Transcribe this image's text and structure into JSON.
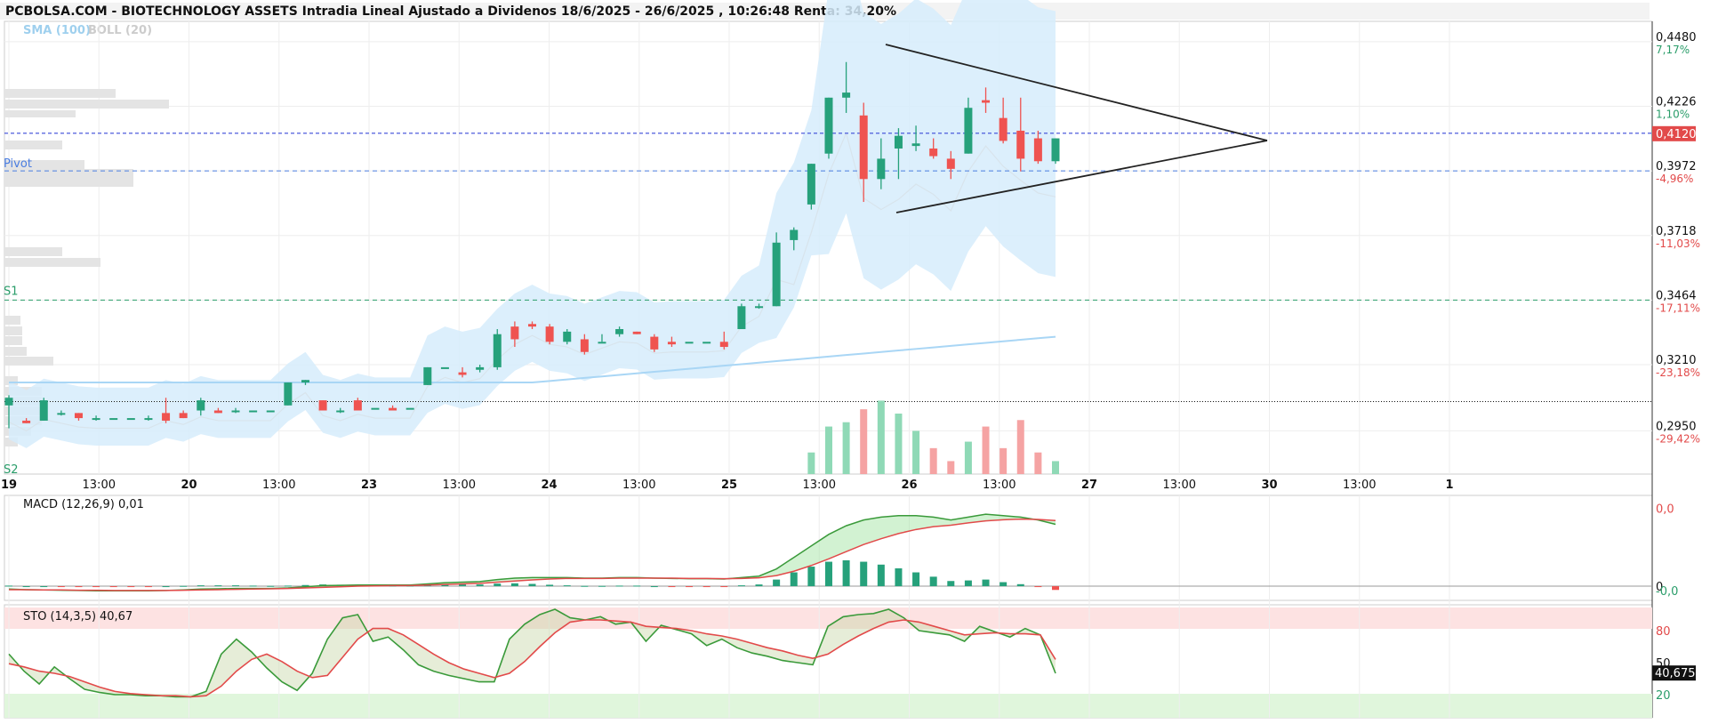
{
  "header": {
    "title": "PCBOLSA.COM - BIOTECHNOLOGY ASSETS Intradia Lineal Ajustado a Dividenos 18/6/2025 - 26/6/2025 , 10:26:48 Renta: 34,20%",
    "sma_label": "SMA (100)",
    "boll_label": "BOLL (20)"
  },
  "colors": {
    "up": "#26a17b",
    "down": "#ef5350",
    "band": "#d6ecfb",
    "sma": "#a9d6f5",
    "pivot": "#4a7de0",
    "s1": "#2a9d6a",
    "last": "#e24a4a"
  },
  "levels": {
    "pivot_label": "Pivot",
    "s1_label": "S1",
    "s2_label": "S2",
    "last_price_label": "0,4120",
    "pivot": 0.3972,
    "s1": 0.3464,
    "last": 0.412,
    "dotted": 0.3065
  },
  "chart_data": [
    {
      "type": "candlestick",
      "ylim": [
        0.278,
        0.456
      ],
      "y_ticks": [
        {
          "value": 0.448,
          "label": "0,4480",
          "pct": "7,17%"
        },
        {
          "value": 0.4226,
          "label": "0,4226",
          "pct": "1,10%"
        },
        {
          "value": 0.3972,
          "label": "0,3972",
          "pct": "-4,96%"
        },
        {
          "value": 0.3718,
          "label": "0,3718",
          "pct": "-11,03%"
        },
        {
          "value": 0.3464,
          "label": "0,3464",
          "pct": "-17,11%"
        },
        {
          "value": 0.321,
          "label": "0,3210",
          "pct": "-23,18%"
        },
        {
          "value": 0.295,
          "label": "0,2950",
          "pct": "-29,42%"
        }
      ],
      "x_ticks": [
        {
          "slot": 0,
          "label": "19",
          "bold": true
        },
        {
          "slot": 4.5,
          "label": "13:00",
          "bold": false
        },
        {
          "slot": 9,
          "label": "20",
          "bold": true
        },
        {
          "slot": 13.5,
          "label": "13:00",
          "bold": false
        },
        {
          "slot": 18,
          "label": "23",
          "bold": true
        },
        {
          "slot": 22.5,
          "label": "13:00",
          "bold": false
        },
        {
          "slot": 27,
          "label": "24",
          "bold": true
        },
        {
          "slot": 31.5,
          "label": "13:00",
          "bold": false
        },
        {
          "slot": 36,
          "label": "25",
          "bold": true
        },
        {
          "slot": 40.5,
          "label": "13:00",
          "bold": false
        },
        {
          "slot": 45,
          "label": "26",
          "bold": true
        },
        {
          "slot": 49.5,
          "label": "13:00",
          "bold": false
        },
        {
          "slot": 54,
          "label": "27",
          "bold": true
        },
        {
          "slot": 58.5,
          "label": "13:00",
          "bold": false
        },
        {
          "slot": 63,
          "label": "30",
          "bold": true
        },
        {
          "slot": 67.5,
          "label": "13:00",
          "bold": false
        },
        {
          "slot": 72,
          "label": "1",
          "bold": true
        }
      ],
      "candles": [
        {
          "o": 0.305,
          "h": 0.309,
          "l": 0.296,
          "c": 0.308
        },
        {
          "o": 0.299,
          "h": 0.3,
          "l": 0.298,
          "c": 0.298
        },
        {
          "o": 0.299,
          "h": 0.308,
          "l": 0.299,
          "c": 0.307
        },
        {
          "o": 0.302,
          "h": 0.303,
          "l": 0.301,
          "c": 0.302
        },
        {
          "o": 0.302,
          "h": 0.302,
          "l": 0.299,
          "c": 0.3
        },
        {
          "o": 0.3,
          "h": 0.301,
          "l": 0.299,
          "c": 0.3
        },
        {
          "o": 0.3,
          "h": 0.3,
          "l": 0.3,
          "c": 0.3
        },
        {
          "o": 0.3,
          "h": 0.3,
          "l": 0.3,
          "c": 0.3
        },
        {
          "o": 0.3,
          "h": 0.301,
          "l": 0.299,
          "c": 0.3
        },
        {
          "o": 0.302,
          "h": 0.308,
          "l": 0.298,
          "c": 0.299
        },
        {
          "o": 0.302,
          "h": 0.303,
          "l": 0.3,
          "c": 0.3
        },
        {
          "o": 0.303,
          "h": 0.308,
          "l": 0.301,
          "c": 0.307
        },
        {
          "o": 0.303,
          "h": 0.304,
          "l": 0.302,
          "c": 0.302
        },
        {
          "o": 0.303,
          "h": 0.304,
          "l": 0.302,
          "c": 0.303
        },
        {
          "o": 0.303,
          "h": 0.303,
          "l": 0.303,
          "c": 0.303
        },
        {
          "o": 0.303,
          "h": 0.303,
          "l": 0.303,
          "c": 0.303
        },
        {
          "o": 0.305,
          "h": 0.314,
          "l": 0.305,
          "c": 0.314
        },
        {
          "o": 0.314,
          "h": 0.315,
          "l": 0.313,
          "c": 0.315
        },
        {
          "o": 0.307,
          "h": 0.307,
          "l": 0.303,
          "c": 0.303
        },
        {
          "o": 0.303,
          "h": 0.304,
          "l": 0.302,
          "c": 0.303
        },
        {
          "o": 0.307,
          "h": 0.308,
          "l": 0.303,
          "c": 0.303
        },
        {
          "o": 0.304,
          "h": 0.304,
          "l": 0.304,
          "c": 0.304
        },
        {
          "o": 0.304,
          "h": 0.305,
          "l": 0.303,
          "c": 0.303
        },
        {
          "o": 0.304,
          "h": 0.304,
          "l": 0.304,
          "c": 0.304
        },
        {
          "o": 0.313,
          "h": 0.32,
          "l": 0.313,
          "c": 0.32
        },
        {
          "o": 0.32,
          "h": 0.32,
          "l": 0.32,
          "c": 0.32
        },
        {
          "o": 0.318,
          "h": 0.32,
          "l": 0.316,
          "c": 0.317
        },
        {
          "o": 0.319,
          "h": 0.321,
          "l": 0.318,
          "c": 0.32
        },
        {
          "o": 0.32,
          "h": 0.335,
          "l": 0.319,
          "c": 0.333
        },
        {
          "o": 0.336,
          "h": 0.338,
          "l": 0.328,
          "c": 0.331
        },
        {
          "o": 0.337,
          "h": 0.338,
          "l": 0.335,
          "c": 0.336
        },
        {
          "o": 0.336,
          "h": 0.337,
          "l": 0.329,
          "c": 0.33
        },
        {
          "o": 0.33,
          "h": 0.335,
          "l": 0.329,
          "c": 0.334
        },
        {
          "o": 0.331,
          "h": 0.333,
          "l": 0.325,
          "c": 0.326
        },
        {
          "o": 0.33,
          "h": 0.333,
          "l": 0.33,
          "c": 0.33
        },
        {
          "o": 0.333,
          "h": 0.336,
          "l": 0.332,
          "c": 0.335
        },
        {
          "o": 0.334,
          "h": 0.334,
          "l": 0.333,
          "c": 0.333
        },
        {
          "o": 0.332,
          "h": 0.333,
          "l": 0.326,
          "c": 0.327
        },
        {
          "o": 0.33,
          "h": 0.332,
          "l": 0.328,
          "c": 0.329
        },
        {
          "o": 0.33,
          "h": 0.33,
          "l": 0.33,
          "c": 0.33
        },
        {
          "o": 0.33,
          "h": 0.33,
          "l": 0.33,
          "c": 0.33
        },
        {
          "o": 0.33,
          "h": 0.334,
          "l": 0.327,
          "c": 0.328
        },
        {
          "o": 0.335,
          "h": 0.345,
          "l": 0.335,
          "c": 0.344
        },
        {
          "o": 0.344,
          "h": 0.345,
          "l": 0.343,
          "c": 0.344
        },
        {
          "o": 0.344,
          "h": 0.373,
          "l": 0.344,
          "c": 0.369
        },
        {
          "o": 0.37,
          "h": 0.375,
          "l": 0.366,
          "c": 0.374
        },
        {
          "o": 0.384,
          "h": 0.4,
          "l": 0.382,
          "c": 0.4
        },
        {
          "o": 0.404,
          "h": 0.426,
          "l": 0.402,
          "c": 0.426
        },
        {
          "o": 0.426,
          "h": 0.44,
          "l": 0.42,
          "c": 0.428
        },
        {
          "o": 0.419,
          "h": 0.424,
          "l": 0.385,
          "c": 0.394
        },
        {
          "o": 0.394,
          "h": 0.41,
          "l": 0.39,
          "c": 0.402
        },
        {
          "o": 0.406,
          "h": 0.414,
          "l": 0.394,
          "c": 0.411
        },
        {
          "o": 0.407,
          "h": 0.415,
          "l": 0.405,
          "c": 0.408
        },
        {
          "o": 0.406,
          "h": 0.41,
          "l": 0.402,
          "c": 0.403
        },
        {
          "o": 0.402,
          "h": 0.405,
          "l": 0.394,
          "c": 0.398
        },
        {
          "o": 0.404,
          "h": 0.426,
          "l": 0.404,
          "c": 0.422
        },
        {
          "o": 0.425,
          "h": 0.43,
          "l": 0.42,
          "c": 0.424
        },
        {
          "o": 0.418,
          "h": 0.426,
          "l": 0.408,
          "c": 0.409
        },
        {
          "o": 0.413,
          "h": 0.426,
          "l": 0.397,
          "c": 0.402
        },
        {
          "o": 0.41,
          "h": 0.413,
          "l": 0.4,
          "c": 0.401
        },
        {
          "o": 0.401,
          "h": 0.41,
          "l": 0.4,
          "c": 0.41
        }
      ]
    },
    {
      "type": "bar",
      "name": "volume",
      "values": [
        0,
        0,
        0,
        0,
        0,
        0,
        0,
        0,
        0,
        0,
        0,
        0,
        0,
        0,
        0,
        0,
        0,
        0,
        0,
        0,
        0,
        0,
        0,
        0,
        0,
        0,
        0,
        0,
        0,
        0,
        0,
        0,
        0,
        0,
        0,
        0,
        0,
        0,
        0,
        0,
        0,
        0,
        0,
        0,
        0,
        0,
        10,
        22,
        24,
        30,
        34,
        28,
        20,
        12,
        6,
        15,
        22,
        12,
        25,
        10,
        6
      ],
      "ylim": [
        0,
        70
      ]
    },
    {
      "type": "line",
      "name": "MACD",
      "label": "MACD (12,26,9)",
      "value_label": "0,01",
      "ylim": [
        -0.004,
        0.03
      ],
      "y_ticks": [
        {
          "value": 0.027,
          "label": "0,0"
        },
        {
          "value": 0.0,
          "label": "0"
        },
        {
          "value": -0.0015,
          "label": "-0,0"
        }
      ],
      "macd": [
        -0.001,
        -0.0012,
        -0.0013,
        -0.0014,
        -0.0015,
        -0.0016,
        -0.0016,
        -0.0016,
        -0.0016,
        -0.0015,
        -0.0013,
        -0.001,
        -0.0009,
        -0.0008,
        -0.0008,
        -0.0008,
        -0.0006,
        -0.0002,
        0.0002,
        0.0003,
        0.0004,
        0.0004,
        0.0004,
        0.0004,
        0.0008,
        0.0012,
        0.0014,
        0.0016,
        0.0023,
        0.0028,
        0.003,
        0.003,
        0.003,
        0.0028,
        0.0028,
        0.003,
        0.003,
        0.0028,
        0.0027,
        0.0026,
        0.0026,
        0.0025,
        0.003,
        0.0035,
        0.006,
        0.01,
        0.014,
        0.018,
        0.021,
        0.023,
        0.024,
        0.0245,
        0.0245,
        0.024,
        0.023,
        0.024,
        0.025,
        0.0245,
        0.024,
        0.023,
        0.0215
      ],
      "signal": [
        -0.0012,
        -0.0012,
        -0.0013,
        -0.0013,
        -0.0014,
        -0.0014,
        -0.0015,
        -0.0015,
        -0.0015,
        -0.0015,
        -0.0014,
        -0.0013,
        -0.0012,
        -0.0011,
        -0.001,
        -0.0009,
        -0.0008,
        -0.0006,
        -0.0004,
        -0.0002,
        0.0,
        0.0001,
        0.0002,
        0.0002,
        0.0004,
        0.0006,
        0.0008,
        0.001,
        0.0014,
        0.0018,
        0.0022,
        0.0025,
        0.0027,
        0.0027,
        0.0027,
        0.0028,
        0.0028,
        0.0028,
        0.0028,
        0.0027,
        0.0027,
        0.0026,
        0.0027,
        0.0029,
        0.0037,
        0.0052,
        0.0072,
        0.0095,
        0.012,
        0.0145,
        0.0165,
        0.0183,
        0.0197,
        0.0207,
        0.0212,
        0.022,
        0.0227,
        0.0231,
        0.0233,
        0.0232,
        0.0228
      ],
      "histogram": [
        0.0002,
        0,
        0,
        -0.0001,
        -0.0001,
        -0.0002,
        -0.0001,
        -0.0001,
        -0.0001,
        0,
        0.0001,
        0.0003,
        0.0003,
        0.0003,
        0.0002,
        0.0001,
        0.0002,
        0.0004,
        0.0006,
        0.0005,
        0.0004,
        0.0003,
        0.0002,
        0.0002,
        0.0004,
        0.0006,
        0.0006,
        0.0006,
        0.0009,
        0.001,
        0.0008,
        0.0005,
        0.0003,
        0.0001,
        0.0001,
        0.0002,
        0.0002,
        0,
        -0.0001,
        -0.0001,
        -0.0001,
        -0.0001,
        0.0003,
        0.0006,
        0.0023,
        0.0048,
        0.0068,
        0.0085,
        0.009,
        0.0085,
        0.0075,
        0.0062,
        0.0048,
        0.0033,
        0.0018,
        0.002,
        0.0023,
        0.0014,
        0.0007,
        -0.0002,
        -0.0013
      ]
    },
    {
      "type": "line",
      "name": "STO",
      "label": "STO (14,3,5)",
      "value_label": "40,67",
      "current_label": "40,675",
      "ylim": [
        0,
        100
      ],
      "y_ticks": [
        {
          "value": 80,
          "label": "80"
        },
        {
          "value": 50,
          "label": "50"
        },
        {
          "value": 20,
          "label": "20"
        }
      ],
      "k": [
        58,
        42,
        30,
        46,
        35,
        25,
        22,
        20,
        20,
        19,
        19,
        18,
        18,
        23,
        58,
        72,
        60,
        45,
        32,
        24,
        40,
        72,
        92,
        95,
        70,
        74,
        62,
        48,
        42,
        38,
        35,
        32,
        32,
        72,
        86,
        95,
        103,
        92,
        90,
        93,
        86,
        88,
        70,
        85,
        81,
        77,
        66,
        72,
        64,
        59,
        56,
        52,
        50,
        48,
        84,
        93,
        95,
        96,
        100,
        92,
        80,
        78,
        76,
        70,
        84,
        79,
        74,
        82,
        76,
        40
      ],
      "d": [
        49,
        46,
        42,
        40,
        37,
        32,
        27,
        23,
        21,
        20,
        19,
        19,
        18,
        19,
        28,
        42,
        53,
        58,
        51,
        42,
        36,
        38,
        55,
        72,
        82,
        82,
        76,
        67,
        58,
        50,
        44,
        40,
        36,
        40,
        51,
        65,
        78,
        88,
        90,
        90,
        89,
        88,
        84,
        83,
        82,
        80,
        77,
        75,
        72,
        68,
        64,
        61,
        57,
        54,
        58,
        67,
        75,
        82,
        88,
        90,
        88,
        84,
        80,
        76,
        77,
        78,
        77,
        77,
        76,
        53
      ]
    }
  ]
}
